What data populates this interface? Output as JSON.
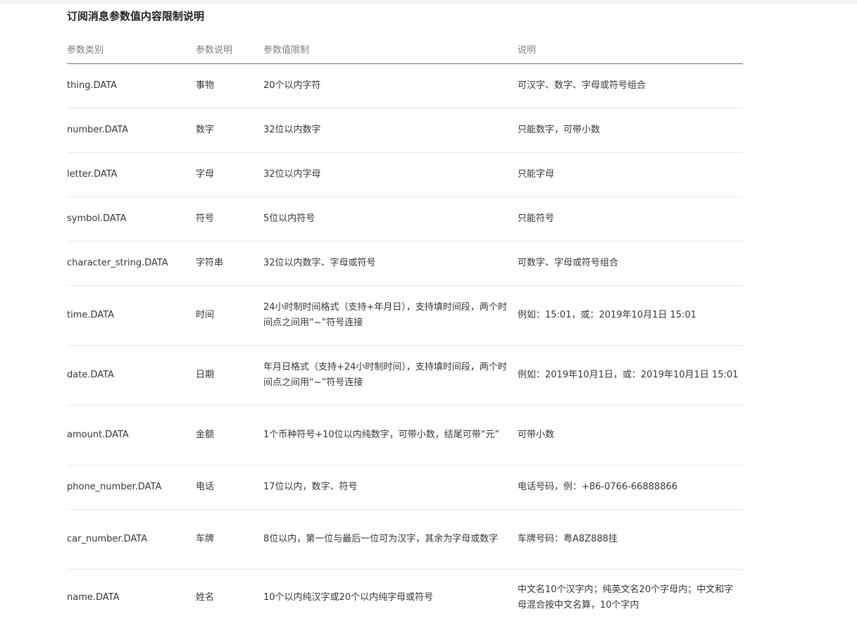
{
  "title": "订阅消息参数值内容限制说明",
  "table": {
    "headers": [
      "参数类别",
      "参数说明",
      "参数值限制",
      "说明"
    ],
    "rows": [
      {
        "category": "thing.DATA",
        "desc": "事物",
        "limit": "20个以内字符",
        "note": "可汉字、数字、字母或符号组合"
      },
      {
        "category": "number.DATA",
        "desc": "数字",
        "limit": "32位以内数字",
        "note": "只能数字，可带小数"
      },
      {
        "category": "letter.DATA",
        "desc": "字母",
        "limit": "32位以内字母",
        "note": "只能字母"
      },
      {
        "category": "symbol.DATA",
        "desc": "符号",
        "limit": "5位以内符号",
        "note": "只能符号"
      },
      {
        "category": "character_string.DATA",
        "desc": "字符串",
        "limit": "32位以内数字、字母或符号",
        "note": "可数字、字母或符号组合"
      },
      {
        "category": "time.DATA",
        "desc": "时间",
        "limit": "24小时制时间格式（支持+年月日），支持填时间段，两个时间点之间用“~”符号连接",
        "note": "例如：15:01，或：2019年10月1日 15:01"
      },
      {
        "category": "date.DATA",
        "desc": "日期",
        "limit": "年月日格式（支持+24小时制时间），支持填时间段，两个时间点之间用“~”符号连接",
        "note": "例如：2019年10月1日，或：2019年10月1日 15:01"
      },
      {
        "category": "amount.DATA",
        "desc": "金额",
        "limit": "1个币种符号+10位以内纯数字，可带小数，结尾可带“元”",
        "note": "可带小数"
      },
      {
        "category": "phone_number.DATA",
        "desc": "电话",
        "limit": "17位以内，数字、符号",
        "note": "电话号码，例：+86-0766-66888866"
      },
      {
        "category": "car_number.DATA",
        "desc": "车牌",
        "limit": "8位以内，第一位与最后一位可为汉字，其余为字母或数字",
        "note": "车牌号码：粤A8Z888挂"
      },
      {
        "category": "name.DATA",
        "desc": "姓名",
        "limit": "10个以内纯汉字或20个以内纯字母或符号",
        "note": "中文名10个汉字内；纯英文名20个字母内；中文和字母混合按中文名算，10个字内"
      }
    ]
  }
}
